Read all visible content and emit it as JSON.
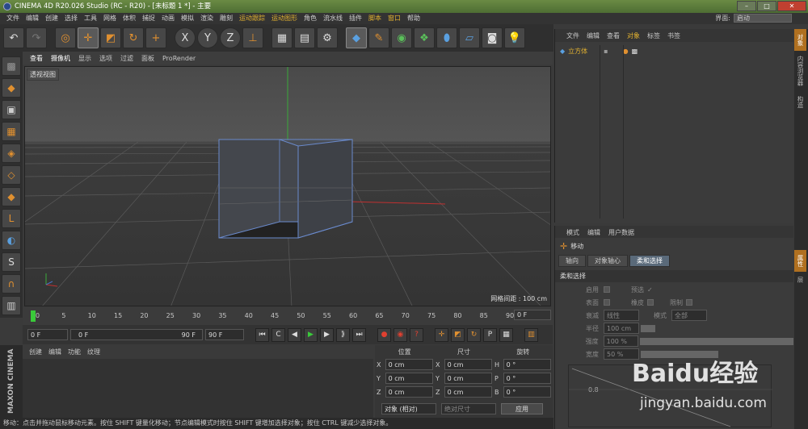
{
  "window": {
    "title": "CINEMA 4D R20.026 Studio (RC - R20) - [未标题 1 *] - 主要"
  },
  "menu": [
    "文件",
    "编辑",
    "创建",
    "选择",
    "工具",
    "网格",
    "体积",
    "捕捉",
    "动画",
    "模拟",
    "渲染",
    "雕刻",
    "运动跟踪",
    "运动图形",
    "角色",
    "流水线",
    "插件",
    "脚本",
    "窗口",
    "帮助"
  ],
  "menu_highlight": [
    "运动跟踪",
    "运动图形",
    "脚本",
    "窗口"
  ],
  "layout": {
    "label": "界面:",
    "value": "启动"
  },
  "toolbar_icons": [
    "undo-icon",
    "redo-icon",
    "live-select-icon",
    "move-icon",
    "scale-icon",
    "rotate-icon",
    "create-icon",
    "x-axis-icon",
    "y-axis-icon",
    "z-axis-icon",
    "coord-system-icon",
    "render-view-icon",
    "render-picture-viewer-icon",
    "render-settings-icon",
    "cube-icon",
    "pen-icon",
    "subdivision-icon",
    "array-icon",
    "deformer-icon",
    "floor-icon",
    "camera-icon",
    "light-icon"
  ],
  "axis_labels": [
    "X",
    "Y",
    "Z"
  ],
  "viewport": {
    "menu": [
      "查看",
      "摄像机",
      "显示",
      "选项",
      "过滤",
      "面板",
      "ProRender"
    ],
    "label": "透视视图",
    "grid_info": "网格间距 : 100 cm"
  },
  "timeline": {
    "ticks": [
      "0",
      "5",
      "10",
      "15",
      "20",
      "25",
      "30",
      "35",
      "40",
      "45",
      "50",
      "55",
      "60",
      "65",
      "70",
      "75",
      "80",
      "85",
      "90"
    ],
    "current": "0 F"
  },
  "playbar": {
    "start": "0 F",
    "range_start": "0 F",
    "range_end": "90 F",
    "end": "90 F"
  },
  "materials_menu": [
    "创建",
    "编辑",
    "功能",
    "纹理"
  ],
  "coords": {
    "headers": [
      "位置",
      "尺寸",
      "旋转"
    ],
    "rows": [
      {
        "a1": "X",
        "v1": "0 cm",
        "a2": "X",
        "v2": "0 cm",
        "a3": "H",
        "v3": "0 °"
      },
      {
        "a1": "Y",
        "v1": "0 cm",
        "a2": "Y",
        "v2": "0 cm",
        "a3": "P",
        "v3": "0 °"
      },
      {
        "a1": "Z",
        "v1": "0 cm",
        "a2": "Z",
        "v2": "0 cm",
        "a3": "B",
        "v3": "0 °"
      }
    ],
    "mode1": "对象 (相对)",
    "mode2": "绝对尺寸",
    "apply": "应用"
  },
  "status": "移动：点击并拖动鼠标移动元素。按住 SHIFT 键量化移动；节点编辑模式时按住 SHIFT 键增加选择对象；按住 CTRL 键减少选择对象。",
  "object_manager": {
    "menu": [
      "文件",
      "编辑",
      "查看",
      "对象",
      "标签",
      "书签"
    ],
    "object": "立方体"
  },
  "attributes": {
    "menu": [
      "模式",
      "编辑",
      "用户数据"
    ],
    "tool": "移动",
    "tabs": [
      "轴向",
      "对象轴心",
      "柔和选择"
    ],
    "section": "柔和选择",
    "rows": {
      "enable": "启用",
      "preview": "预选",
      "surface": "表面",
      "rubber": "橡皮",
      "restrict": "限制",
      "falloff": "衰减",
      "falloff_value": "线性",
      "mode": "模式",
      "mode_value": "全部",
      "radius": "半径",
      "radius_value": "100 cm",
      "strength": "强度",
      "strength_value": "100 %",
      "width": "宽度",
      "width_value": "50 %"
    },
    "graph_label": "0.8"
  },
  "right_tabs": [
    "对象",
    "内容浏览器",
    "构造",
    "属性",
    "层"
  ],
  "maxon": "MAXON CINEMA 4D",
  "watermark": {
    "brand": "Baidu经验",
    "url": "jingyan.baidu.com"
  },
  "colors": {
    "accent": "#e09030",
    "title_bar": "#5a7a3c",
    "highlight": "#e0b030"
  }
}
